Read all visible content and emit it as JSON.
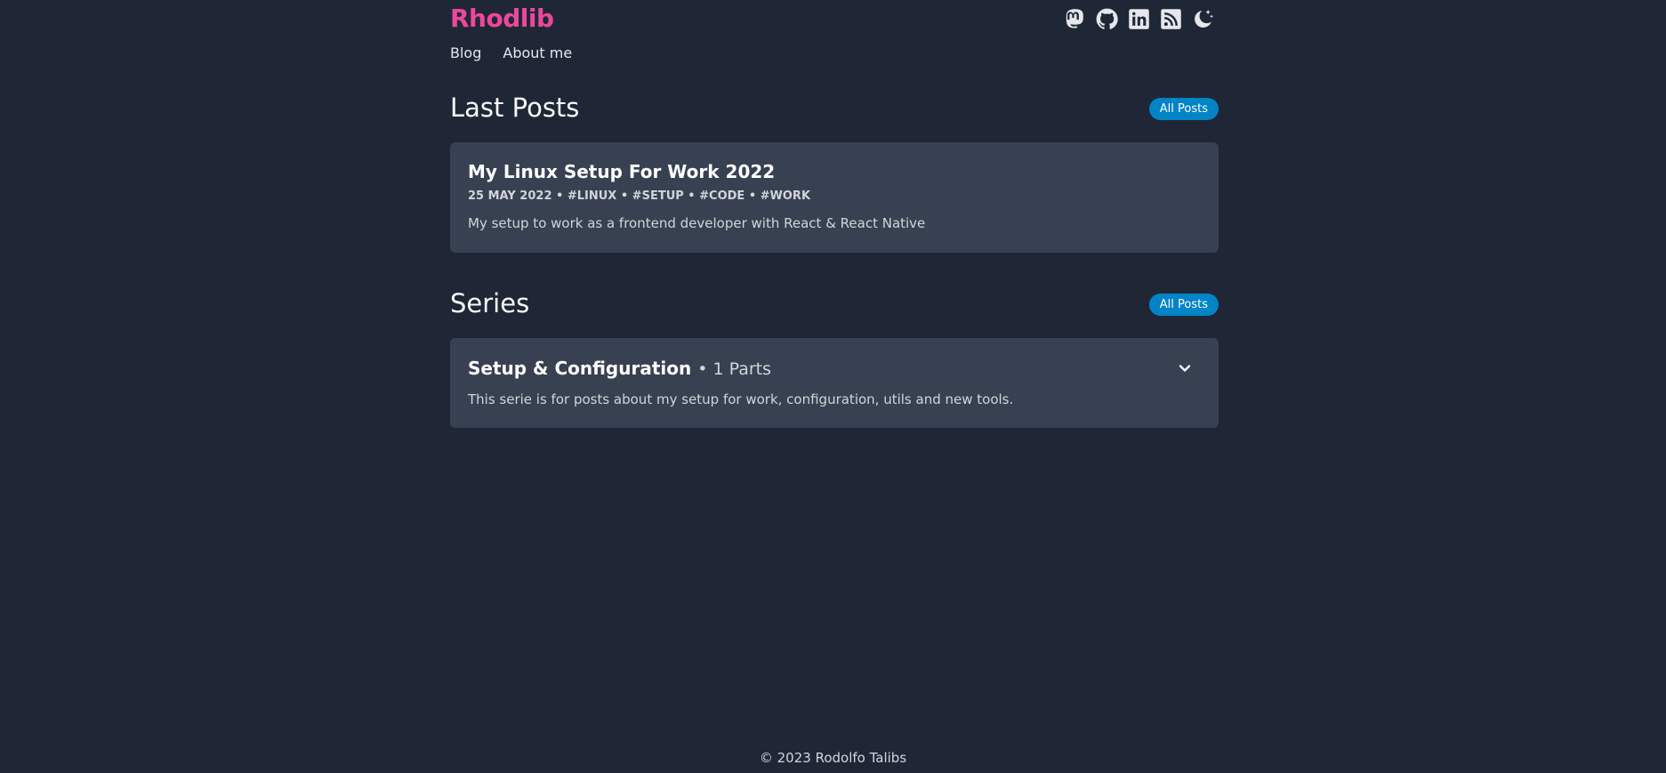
{
  "header": {
    "brand": "Rhodlib",
    "icons": [
      "mastodon-icon",
      "github-icon",
      "linkedin-icon",
      "rss-icon",
      "theme-toggle-icon"
    ],
    "nav": [
      {
        "label": "Blog"
      },
      {
        "label": "About me"
      }
    ]
  },
  "last_posts": {
    "title": "Last Posts",
    "all_label": "All Posts",
    "posts": [
      {
        "title": "My Linux Setup For Work 2022",
        "meta": "25 MAY 2022 • #LINUX • #SETUP • #CODE • #WORK",
        "description": "My setup to work as a frontend developer with React & React Native"
      }
    ]
  },
  "series": {
    "title": "Series",
    "all_label": "All Posts",
    "items": [
      {
        "title": "Setup & Configuration",
        "parts": "• 1 Parts",
        "description": "This serie is for posts about my setup for work, configuration, utils and new tools."
      }
    ]
  },
  "footer": {
    "text": "© 2023 Rodolfo Talibs"
  },
  "colors": {
    "background": "#1f2737",
    "card": "#374151",
    "brand": "#ec4899",
    "pill": "#0284c7"
  }
}
